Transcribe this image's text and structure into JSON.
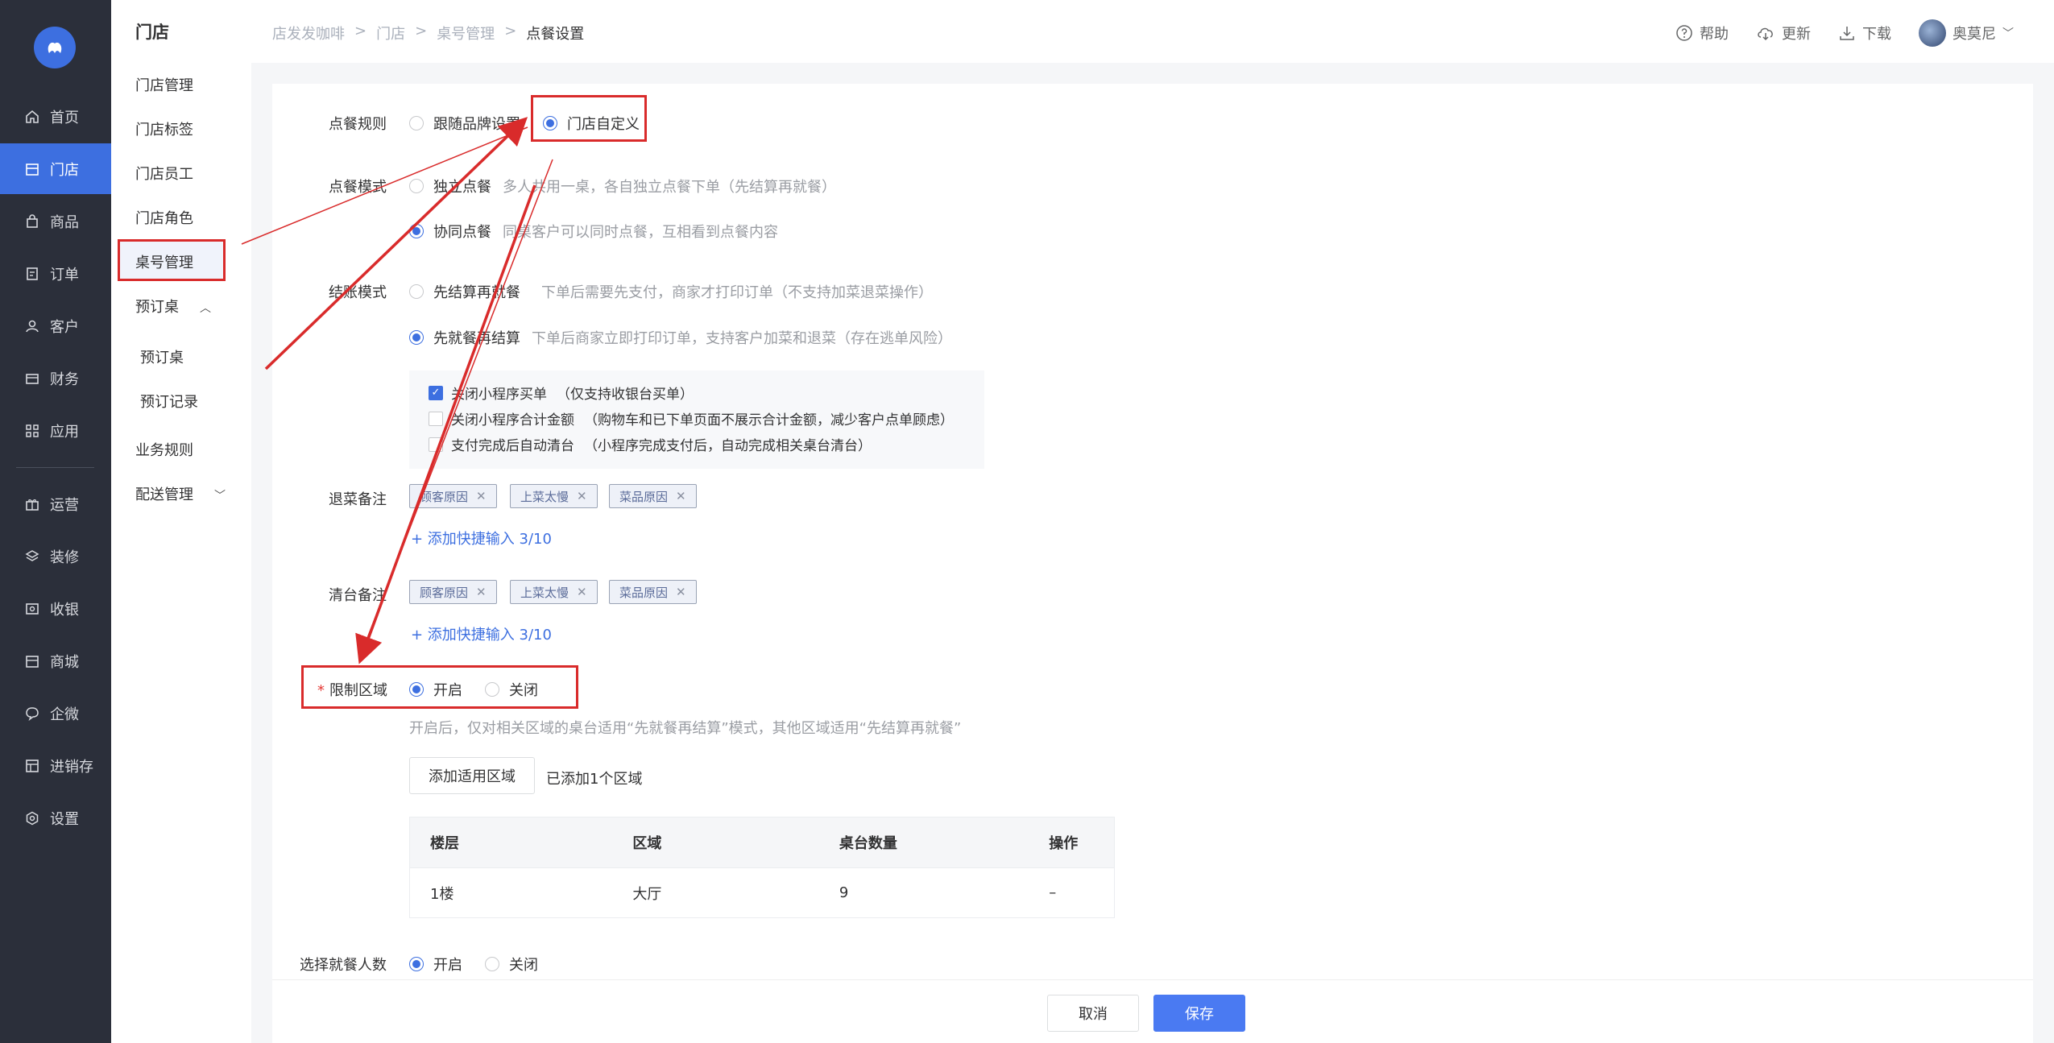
{
  "nav": {
    "items": [
      {
        "label": "首页",
        "icon": "home-icon"
      },
      {
        "label": "门店",
        "icon": "store-icon",
        "active": true
      },
      {
        "label": "商品",
        "icon": "bag-icon"
      },
      {
        "label": "订单",
        "icon": "order-icon"
      },
      {
        "label": "客户",
        "icon": "user-icon"
      },
      {
        "label": "财务",
        "icon": "wallet-icon"
      },
      {
        "label": "应用",
        "icon": "apps-icon"
      },
      {
        "label": "运营",
        "icon": "gift-icon"
      },
      {
        "label": "装修",
        "icon": "layers-icon"
      },
      {
        "label": "收银",
        "icon": "cashier-icon"
      },
      {
        "label": "商城",
        "icon": "shop-icon"
      },
      {
        "label": "企微",
        "icon": "chat-icon"
      },
      {
        "label": "进销存",
        "icon": "inventory-icon"
      },
      {
        "label": "设置",
        "icon": "gear-icon"
      }
    ]
  },
  "subnav": {
    "title": "门店",
    "items": [
      "门店管理",
      "门店标签",
      "门店员工",
      "门店角色",
      "桌号管理",
      "预订桌",
      "预订桌",
      "预订记录",
      "业务规则",
      "配送管理"
    ]
  },
  "breadcrumb": [
    "店发发咖啡",
    "门店",
    "桌号管理",
    "点餐设置"
  ],
  "top": {
    "help": "帮助",
    "update": "更新",
    "download": "下载",
    "user": "奥莫尼"
  },
  "form": {
    "order_rule": {
      "label": "点餐规则",
      "options": [
        "跟随品牌设置",
        "门店自定义"
      ],
      "selected": "门店自定义"
    },
    "order_mode": {
      "label": "点餐模式",
      "opt1": "独立点餐",
      "opt1_hint": "多人共用一桌，各自独立点餐下单（先结算再就餐）",
      "opt2": "协同点餐",
      "opt2_hint": "同桌客户可以同时点餐，互相看到点餐内容",
      "selected": "协同点餐"
    },
    "checkout_mode": {
      "label": "结账模式",
      "opt1": "先结算再就餐",
      "opt1_hint": "下单后需要先支付，商家才打印订单（不支持加菜退菜操作）",
      "opt2": "先就餐再结算",
      "opt2_hint": "下单后商家立即打印订单，支持客户加菜和退菜（存在逃单风险）",
      "selected": "先就餐再结算",
      "checks": [
        {
          "label": "关闭小程序买单",
          "hint": "（仅支持收银台买单）",
          "checked": true
        },
        {
          "label": "关闭小程序合计金额",
          "hint": "（购物车和已下单页面不展示合计金额，减少客户点单顾虑）",
          "checked": false
        },
        {
          "label": "支付完成后自动清台",
          "hint": "（小程序完成支付后，自动完成相关桌台清台）",
          "checked": false
        }
      ]
    },
    "refund_note": {
      "label": "退菜备注",
      "tags": [
        "顾客原因",
        "上菜太慢",
        "菜品原因"
      ],
      "add": "+ 添加快捷输入 3/10"
    },
    "clear_note": {
      "label": "清台备注",
      "tags": [
        "顾客原因",
        "上菜太慢",
        "菜品原因"
      ],
      "add": "+ 添加快捷输入 3/10"
    },
    "limit_area": {
      "label": "限制区域",
      "required": "*",
      "options": [
        "开启",
        "关闭"
      ],
      "selected": "开启",
      "hint": "开启后，仅对相关区域的桌台适用“先就餐再结算”模式，其他区域适用“先结算再就餐”",
      "add_button": "添加适用区域",
      "added_text": "已添加1个区域"
    },
    "area_table": {
      "headers": [
        "楼层",
        "区域",
        "桌台数量",
        "操作"
      ],
      "rows": [
        [
          "1楼",
          "大厅",
          "9",
          "–"
        ]
      ]
    },
    "diners": {
      "label": "选择就餐人数",
      "options": [
        "开启",
        "关闭"
      ],
      "selected": "开启"
    }
  },
  "footer": {
    "cancel": "取消",
    "save": "保存"
  },
  "colors": {
    "accent": "#3d6fe0",
    "nav_bg": "#2b2f3a",
    "annotation": "#d92b2b"
  }
}
